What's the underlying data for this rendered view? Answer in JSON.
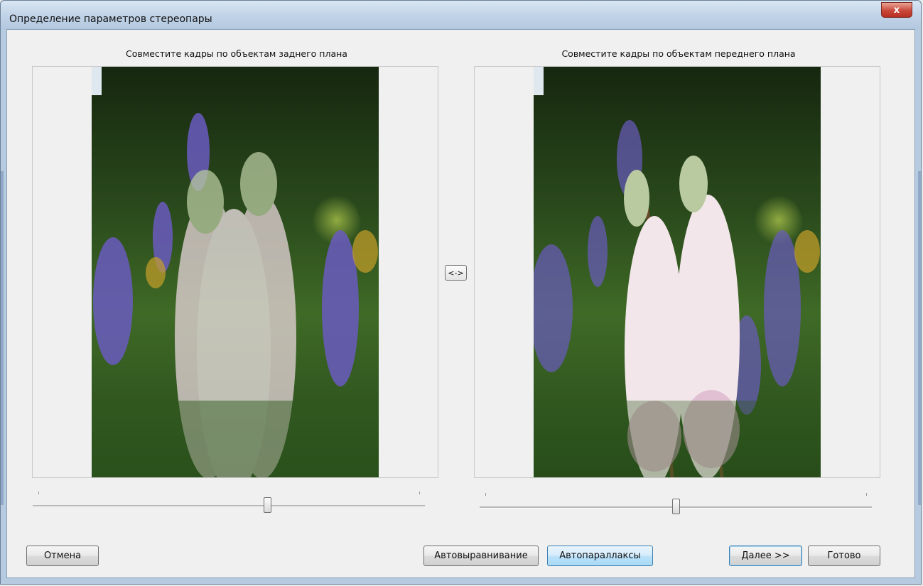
{
  "window": {
    "title": "Определение параметров стереопары",
    "close_glyph": "x"
  },
  "left_panel": {
    "label": "Совместите кадры по объектам заднего плана",
    "image": "lupine-flowers-photo",
    "slider_value": 0.6
  },
  "right_panel": {
    "label": "Совместите кадры по объектам переднего плана",
    "image": "lupine-flowers-photo",
    "slider_value": 0.5
  },
  "swap_button": {
    "label": "<->"
  },
  "buttons": {
    "cancel": "Отмена",
    "auto_align": "Автовыравнивание",
    "auto_parallax": "Автопараллаксы",
    "next": "Далее >>",
    "done": "Готово"
  },
  "colors": {
    "accent_button": "#bde3f9",
    "close_button": "#c9483a",
    "titlebar": "#c2d4e8"
  }
}
